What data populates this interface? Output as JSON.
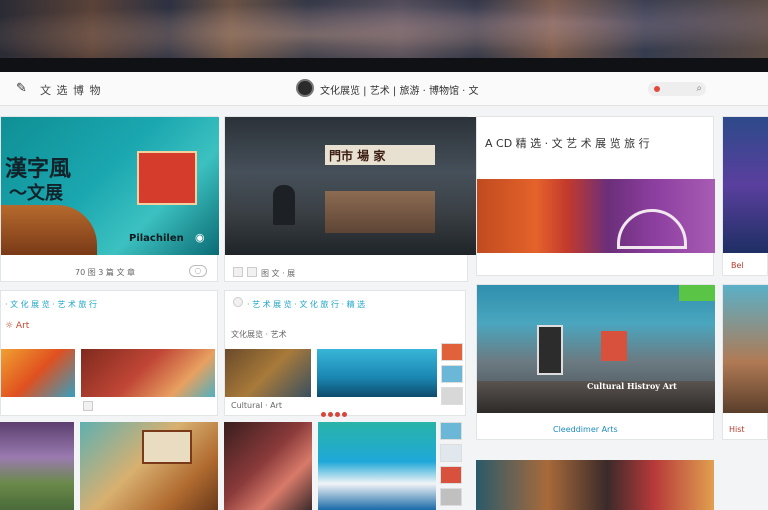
{
  "header": {
    "app_title": "文 选  博 物",
    "page_title": "文化展览 | 艺术 | 旅游 · 博物馆 · 文"
  },
  "cards": {
    "hero_caption": "Pilachilen",
    "hero_meta": "70 图 3 篇 文 章",
    "market_meta": "图 文 · 展",
    "gallery_heading": "A CD 精 选 · 文 艺 术 展 览 旅 行",
    "feed_left_title": "· 文 化 展 览 · 艺 术 旅 行",
    "feed_mid_title": "· 艺 术 展 览  · 文 化 旅 行 · 精 选",
    "feed_mid_sub": "文化展览 · 艺术",
    "feed_thumb_caption": "Cultural · Art",
    "promo_label": "Cultural Histroy Art",
    "promo_link": "Cleeddimer Arts",
    "side_top_label": "Bel",
    "side_bottom_label": "Hist"
  },
  "colors": {
    "accent": "#1fa6c9",
    "alert_red": "#d63c2c",
    "tag_green": "#59c445"
  }
}
